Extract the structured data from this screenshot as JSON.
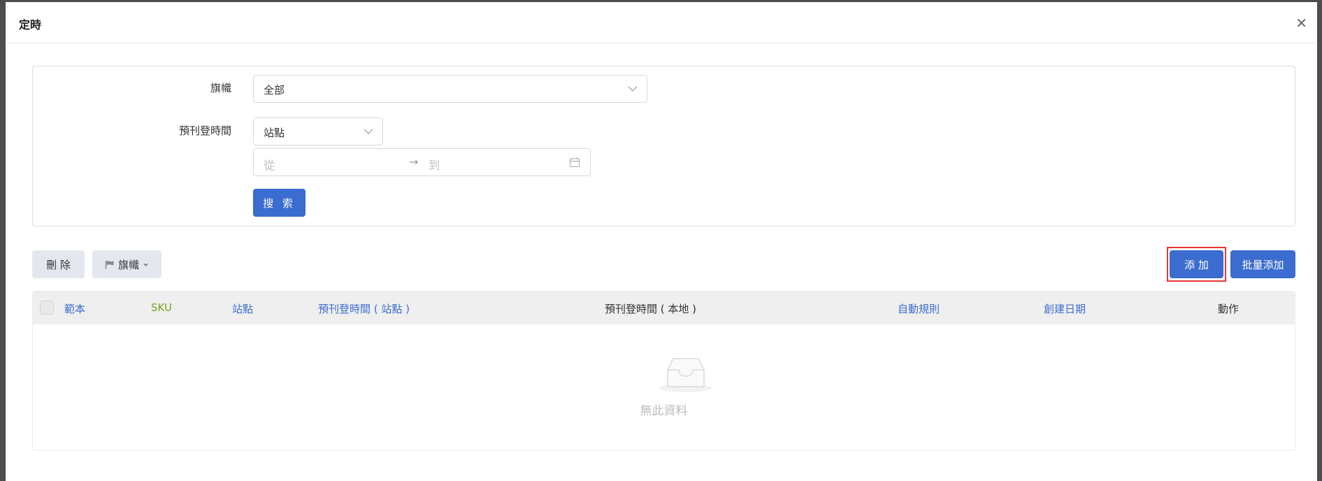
{
  "modal": {
    "title": "定時",
    "close_icon": "close-icon"
  },
  "filter": {
    "flag_label": "旗幟",
    "flag_value": "全部",
    "schedule_label": "預刊登時間",
    "timezone_value": "站點",
    "date_from_placeholder": "從",
    "date_arrow": "→",
    "date_to_placeholder": "到",
    "search_label": "搜 索"
  },
  "toolbar": {
    "delete_label": "刪 除",
    "flag_menu_label": "旗幟",
    "add_label": "添 加",
    "batch_add_label": "批量添加"
  },
  "table": {
    "columns": [
      "範本",
      "SKU",
      "站點",
      "預刊登時間 ( 站點 )",
      "預刊登時間 ( 本地 )",
      "自動規則",
      "創建日期",
      "動作"
    ],
    "empty_text": "無此資料"
  },
  "colors": {
    "primary": "#3b6ccf",
    "highlight": "#e53935",
    "sku": "#7aa51c"
  }
}
